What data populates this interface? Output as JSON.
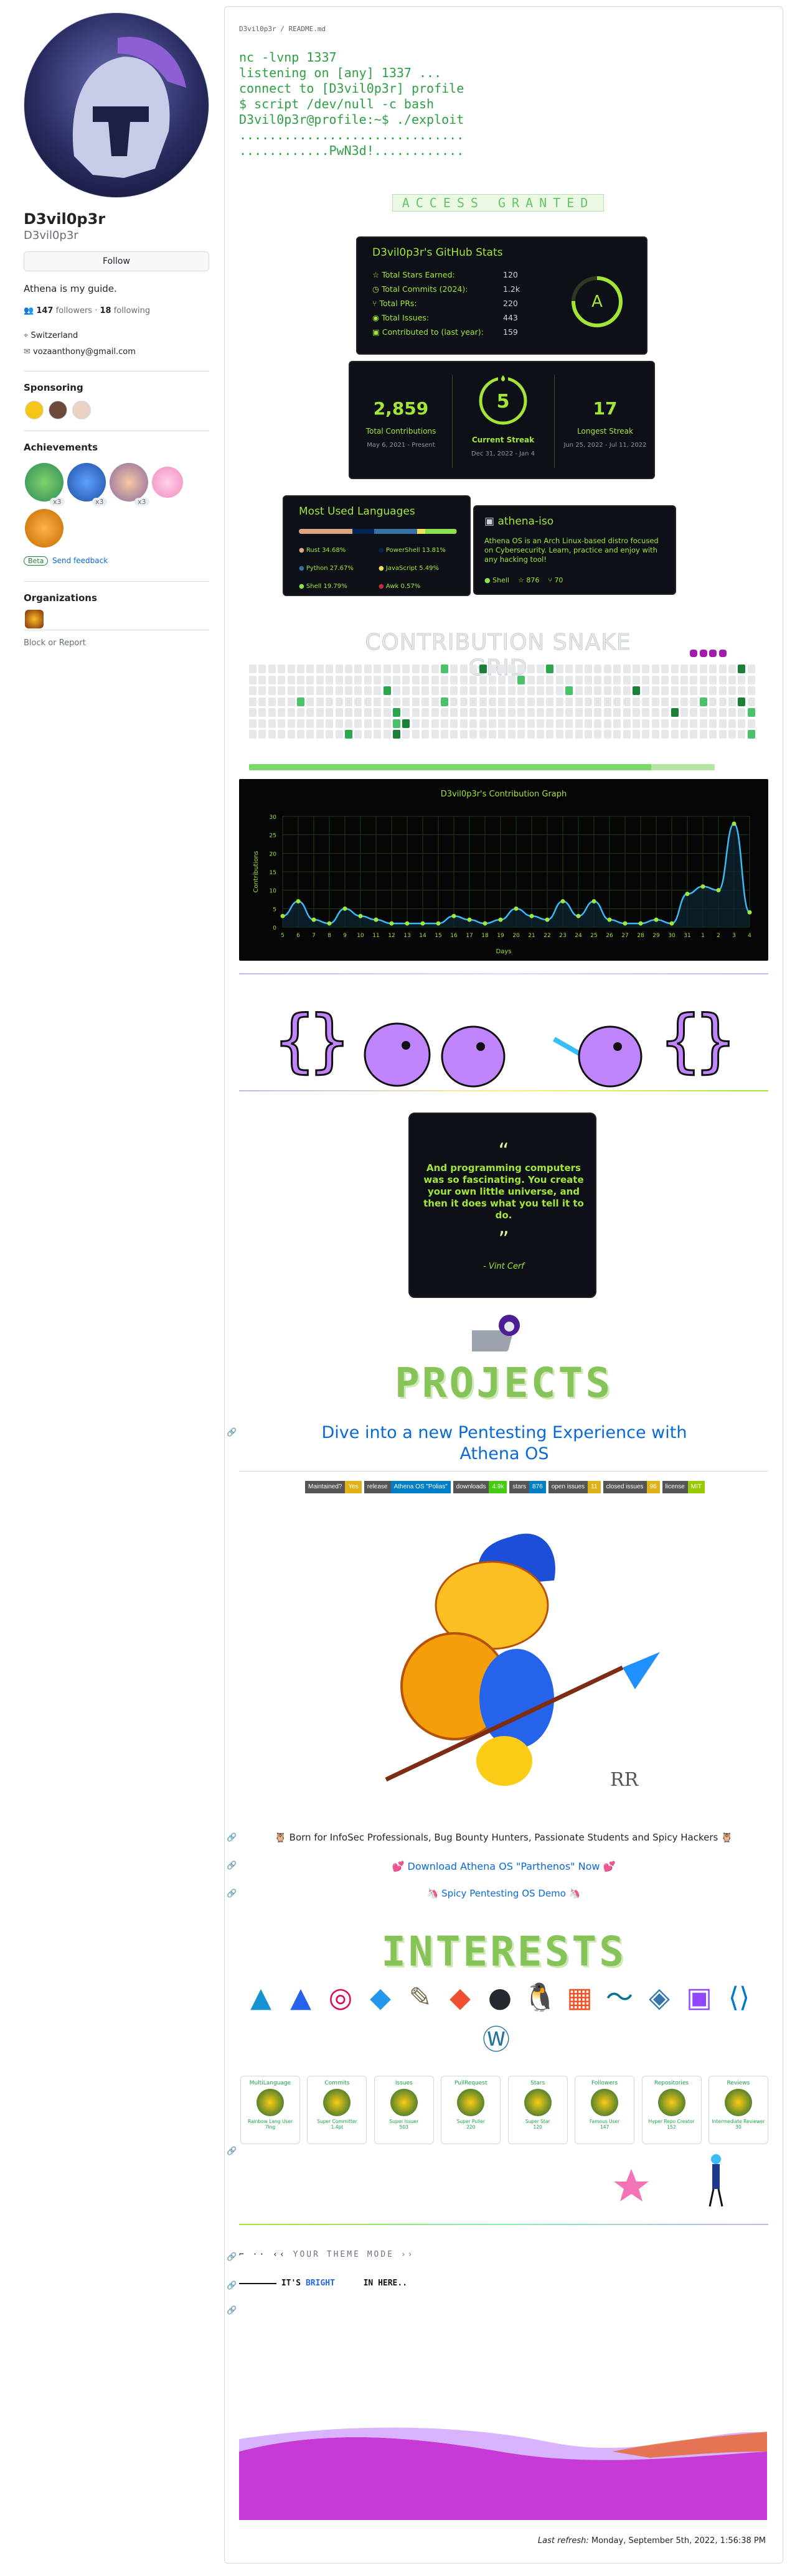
{
  "profile": {
    "name": "D3vil0p3r",
    "handle": "D3vil0p3r",
    "follow_label": "Follow",
    "bio": "Athena is my guide.",
    "followers_count": "147",
    "followers_label": "followers",
    "following_count": "18",
    "following_label": "following",
    "location": "Switzerland",
    "email": "vozaanthony@gmail.com"
  },
  "sidebar": {
    "sponsoring_title": "Sponsoring",
    "achievements_title": "Achievements",
    "achievement_counts": [
      "x3",
      "x3",
      "x3"
    ],
    "beta_label": "Beta",
    "send_feedback": "Send feedback",
    "organizations_title": "Organizations",
    "block_report": "Block or Report"
  },
  "readme": {
    "path": "D3vil0p3r / README.md",
    "terminal": [
      "nc -lvnp 1337",
      "listening on [any] 1337 ...",
      "connect to [D3vil0p3r] profile",
      "$ script /dev/null -c bash",
      "D3vil0p3r@profile:~$ ./exploit",
      "..............................",
      "............PwN3d!............"
    ],
    "access_banner": "ACCESS GRANTED"
  },
  "stats": {
    "title": "D3vil0p3r's GitHub Stats",
    "rows": [
      {
        "label": "Total Stars Earned:",
        "value": "120"
      },
      {
        "label": "Total Commits (2024):",
        "value": "1.2k"
      },
      {
        "label": "Total PRs:",
        "value": "220"
      },
      {
        "label": "Total Issues:",
        "value": "443"
      },
      {
        "label": "Contributed to (last year):",
        "value": "159"
      }
    ],
    "grade": "A"
  },
  "streak": {
    "total": "2,859",
    "total_label": "Total Contributions",
    "total_range": "May 6, 2021 - Present",
    "current": "5",
    "current_label": "Current Streak",
    "current_range": "Dec 31, 2022 - Jan 4",
    "longest": "17",
    "longest_label": "Longest Streak",
    "longest_range": "Jun 25, 2022 - Jul 11, 2022"
  },
  "languages": {
    "title": "Most Used Languages",
    "items": [
      {
        "name": "Rust",
        "pct": "34.68%",
        "color": "#dea584",
        "value": 34.68
      },
      {
        "name": "PowerShell",
        "pct": "13.81%",
        "color": "#012456",
        "value": 13.81
      },
      {
        "name": "Python",
        "pct": "27.67%",
        "color": "#3572A5",
        "value": 27.67
      },
      {
        "name": "JavaScript",
        "pct": "5.49%",
        "color": "#f1e05a",
        "value": 5.49
      },
      {
        "name": "Shell",
        "pct": "19.79%",
        "color": "#89e051",
        "value": 19.79
      },
      {
        "name": "Awk",
        "pct": "0.57%",
        "color": "#c22d40",
        "value": 0.57
      }
    ]
  },
  "repo_card": {
    "name": "athena-iso",
    "description": "Athena OS is an Arch Linux-based distro focused on Cybersecurity. Learn, practice and enjoy with any hacking tool!",
    "lang": "Shell",
    "stars": "876",
    "forks": "70"
  },
  "snake": {
    "title": "CONTRIBUTION SNAKE GRID"
  },
  "chart_data": {
    "type": "line",
    "title": "D3vil0p3r's Contribution Graph",
    "xlabel": "Days",
    "ylabel": "Contributions",
    "x": [
      "5",
      "6",
      "7",
      "8",
      "9",
      "10",
      "11",
      "12",
      "13",
      "14",
      "15",
      "16",
      "17",
      "18",
      "19",
      "20",
      "21",
      "22",
      "23",
      "24",
      "25",
      "26",
      "27",
      "28",
      "29",
      "30",
      "31",
      "1",
      "2",
      "3",
      "4"
    ],
    "values": [
      3,
      7,
      2,
      1,
      5,
      3,
      2,
      1,
      1,
      1,
      1,
      3,
      2,
      1,
      2,
      5,
      3,
      2,
      7,
      3,
      7,
      2,
      1,
      1,
      2,
      1,
      9,
      11,
      10,
      28,
      4
    ],
    "ylim": [
      0,
      30
    ],
    "yticks": [
      0,
      5,
      10,
      15,
      20,
      25,
      30
    ],
    "grid": true
  },
  "quote": {
    "text": "And programming computers was so fascinating. You create your own little universe, and then it does what you tell it to do.",
    "author": "- Vint Cerf"
  },
  "projects": {
    "title": "PROJECTS",
    "headline": "Dive into a new Pentesting Experience with Athena OS",
    "shields": [
      {
        "k": "Maintained?",
        "v": "Yes",
        "kc": "#555555",
        "vc": "#dfb317"
      },
      {
        "k": "release",
        "v": "Athena OS \"Polias\"",
        "kc": "#555555",
        "vc": "#007ec6"
      },
      {
        "k": "downloads",
        "v": "4.9k",
        "kc": "#555555",
        "vc": "#4c1"
      },
      {
        "k": "stars",
        "v": "876",
        "kc": "#555555",
        "vc": "#007ec6"
      },
      {
        "k": "open issues",
        "v": "11",
        "kc": "#555555",
        "vc": "#dfb317"
      },
      {
        "k": "closed issues",
        "v": "96",
        "kc": "#555555",
        "vc": "#dfb317"
      },
      {
        "k": "license",
        "v": "MIT",
        "kc": "#555555",
        "vc": "#97ca00"
      }
    ],
    "born_for": "🦉 Born for InfoSec Professionals, Bug Bounty Hunters, Passionate Students and Spicy Hackers 🦉",
    "download": "💕 Download Athena OS \"Parthenos\" Now 💕",
    "demo": "🦄 Spicy Pentesting OS Demo 🦄"
  },
  "interests": {
    "title": "INTERESTS",
    "icons": [
      "arch-icon",
      "athena-icon",
      "debian-icon",
      "docker-icon",
      "gimp-icon",
      "git-icon",
      "github-icon",
      "linux-icon",
      "windows-icon",
      "mysql-icon",
      "python-icon",
      "twitch-icon",
      "vscode-icon",
      "wordpress-icon"
    ]
  },
  "trophies": [
    {
      "title": "MultiLanguage",
      "rank": "Rainbow Lang User",
      "sub": "7lng"
    },
    {
      "title": "Commits",
      "rank": "Super Committer",
      "sub": "1.4pt"
    },
    {
      "title": "Issues",
      "rank": "Super Issuer",
      "sub": "503"
    },
    {
      "title": "PullRequest",
      "rank": "Super Puller",
      "sub": "220"
    },
    {
      "title": "Stars",
      "rank": "Super Star",
      "sub": "120"
    },
    {
      "title": "Followers",
      "rank": "Famous User",
      "sub": "147"
    },
    {
      "title": "Repositories",
      "rank": "Hyper Repo Creator",
      "sub": "152"
    },
    {
      "title": "Reviews",
      "rank": "Intermediate Reviewer",
      "sub": "30"
    }
  ],
  "theme": {
    "line1": "YOUR THEME MODE",
    "line2_prefix": "IT'S",
    "line2_word": "BRIGHT",
    "line2_suffix": "IN HERE.."
  },
  "footer": {
    "label": "Last refresh:",
    "value": "Monday, September 5th, 2022, 1:56:38 PM"
  }
}
